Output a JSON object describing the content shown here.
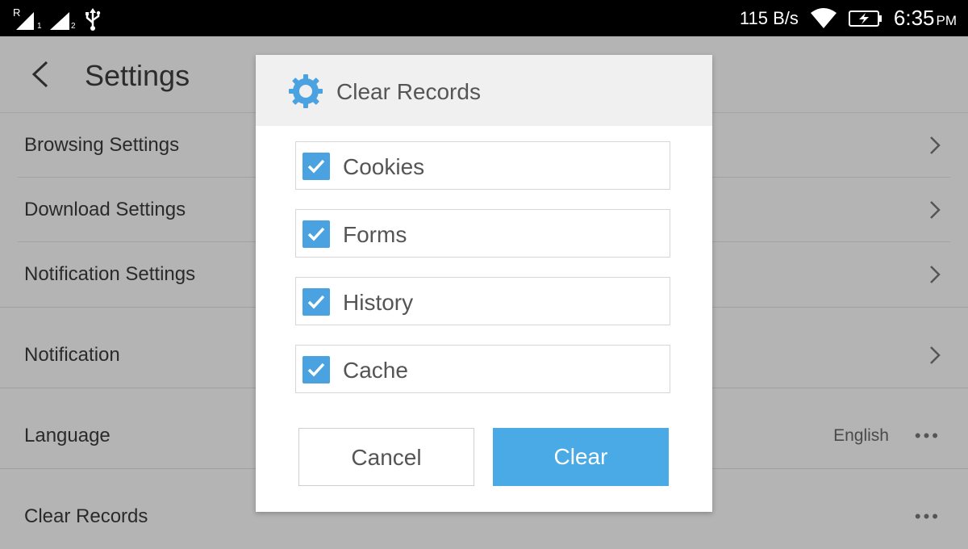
{
  "status_bar": {
    "sim1_label": "R",
    "sim1_sub": "!",
    "sim1_num": "1",
    "sim2_num": "2",
    "net_speed": "115 B/s",
    "time": "6:35",
    "ampm": "PM"
  },
  "settings": {
    "title": "Settings",
    "items": [
      {
        "label": "Browsing Settings"
      },
      {
        "label": "Download Settings"
      },
      {
        "label": "Notification Settings"
      },
      {
        "label": "Notification"
      },
      {
        "label": "Language",
        "value": "English"
      },
      {
        "label": "Clear Records"
      }
    ]
  },
  "dialog": {
    "title": "Clear Records",
    "options": [
      {
        "label": "Cookies",
        "checked": true
      },
      {
        "label": "Forms",
        "checked": true
      },
      {
        "label": "History",
        "checked": true
      },
      {
        "label": "Cache",
        "checked": true
      }
    ],
    "cancel_label": "Cancel",
    "clear_label": "Clear"
  },
  "colors": {
    "accent": "#4aaae6",
    "checkbox": "#4aa3e0",
    "overlay_bg": "#b4b4b4"
  },
  "icons": [
    "back-icon",
    "gear-icon",
    "chevron-right-icon",
    "more-dots-icon",
    "checkmark-icon",
    "wifi-icon",
    "battery-charging-icon",
    "usb-icon",
    "signal-icon"
  ]
}
